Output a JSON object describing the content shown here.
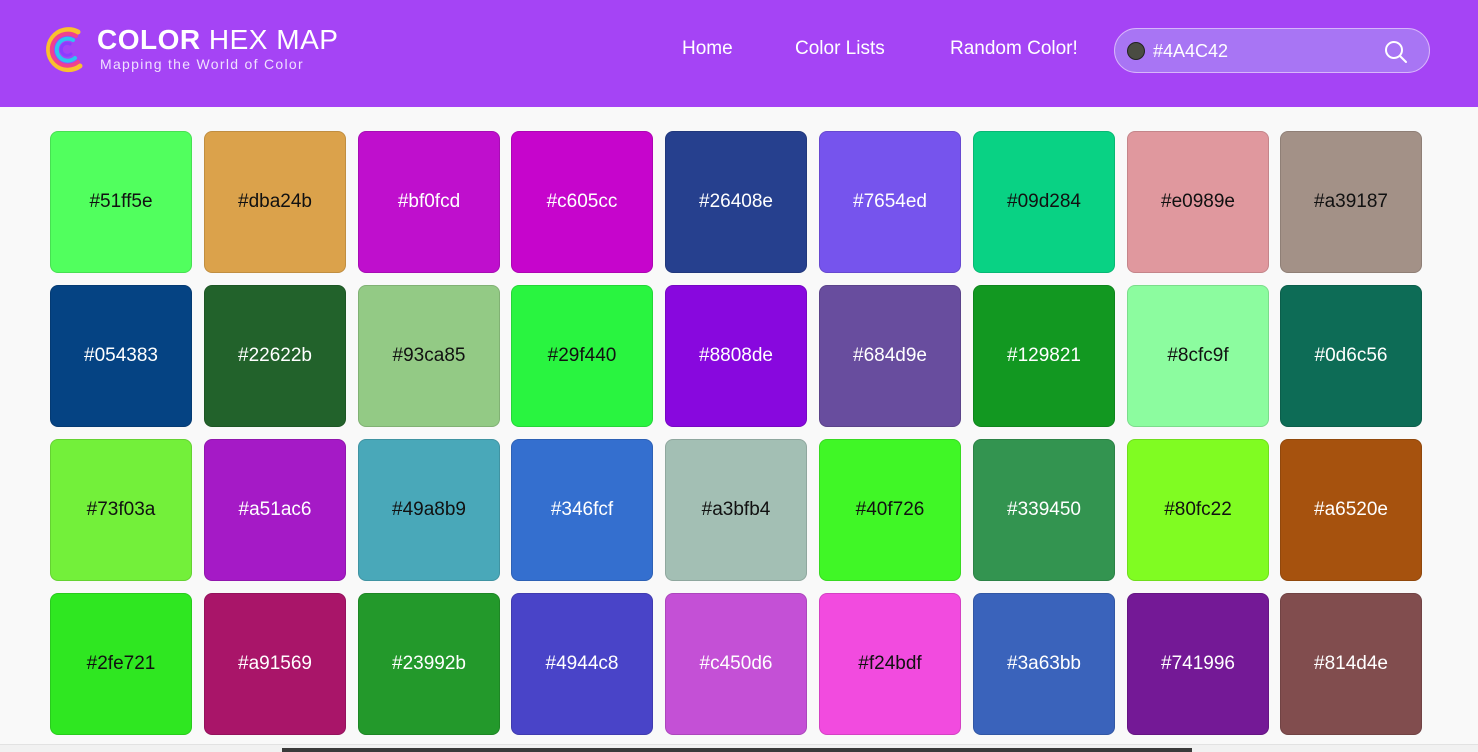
{
  "brand": {
    "title_bold": "COLOR",
    "title_light": "HEX MAP",
    "tagline": "Mapping the World of Color",
    "colors": [
      "#f9c12e",
      "#f0418e",
      "#2fc4f0",
      "#8b3dff"
    ]
  },
  "nav": {
    "home": "Home",
    "color_lists": "Color Lists",
    "random": "Random Color!"
  },
  "search": {
    "value": "#4A4C42",
    "swatch_color": "#4a4c42"
  },
  "tiles": [
    {
      "hex": "#51ff5e",
      "dark_text": true
    },
    {
      "hex": "#dba24b",
      "dark_text": true
    },
    {
      "hex": "#bf0fcd",
      "dark_text": false
    },
    {
      "hex": "#c605cc",
      "dark_text": false
    },
    {
      "hex": "#26408e",
      "dark_text": false
    },
    {
      "hex": "#7654ed",
      "dark_text": false
    },
    {
      "hex": "#09d284",
      "dark_text": true
    },
    {
      "hex": "#e0989e",
      "dark_text": true
    },
    {
      "hex": "#a39187",
      "dark_text": true
    },
    {
      "hex": "#054383",
      "dark_text": false
    },
    {
      "hex": "#22622b",
      "dark_text": false
    },
    {
      "hex": "#93ca85",
      "dark_text": true
    },
    {
      "hex": "#29f440",
      "dark_text": true
    },
    {
      "hex": "#8808de",
      "dark_text": false
    },
    {
      "hex": "#684d9e",
      "dark_text": false
    },
    {
      "hex": "#129821",
      "dark_text": false
    },
    {
      "hex": "#8cfc9f",
      "dark_text": true
    },
    {
      "hex": "#0d6c56",
      "dark_text": false
    },
    {
      "hex": "#73f03a",
      "dark_text": true
    },
    {
      "hex": "#a51ac6",
      "dark_text": false
    },
    {
      "hex": "#49a8b9",
      "dark_text": true
    },
    {
      "hex": "#346fcf",
      "dark_text": false
    },
    {
      "hex": "#a3bfb4",
      "dark_text": true
    },
    {
      "hex": "#40f726",
      "dark_text": true
    },
    {
      "hex": "#339450",
      "dark_text": false
    },
    {
      "hex": "#80fc22",
      "dark_text": true
    },
    {
      "hex": "#a6520e",
      "dark_text": false
    },
    {
      "hex": "#2fe721",
      "dark_text": true
    },
    {
      "hex": "#a91569",
      "dark_text": false
    },
    {
      "hex": "#23992b",
      "dark_text": false
    },
    {
      "hex": "#4944c8",
      "dark_text": false
    },
    {
      "hex": "#c450d6",
      "dark_text": false
    },
    {
      "hex": "#f24bdf",
      "dark_text": true
    },
    {
      "hex": "#3a63bb",
      "dark_text": false
    },
    {
      "hex": "#741996",
      "dark_text": false
    },
    {
      "hex": "#814d4e",
      "dark_text": false
    }
  ]
}
